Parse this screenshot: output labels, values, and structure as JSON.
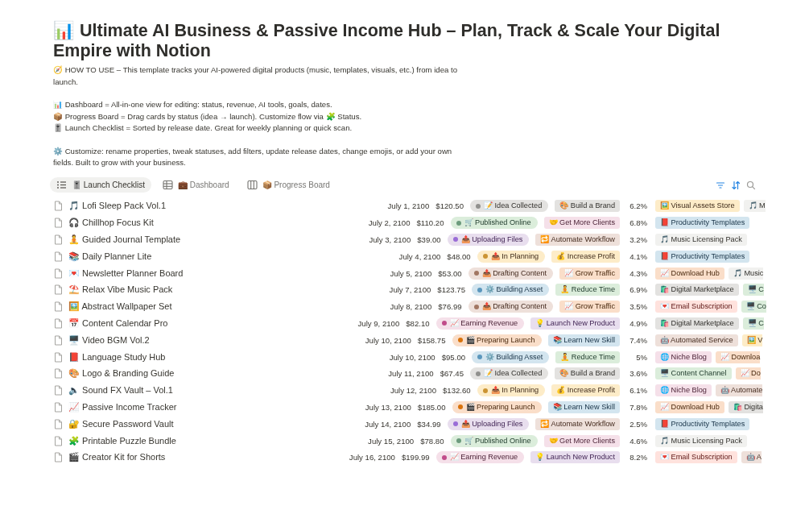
{
  "page": {
    "title": "📊 Ultimate AI Business & Passive Income Hub – Plan, Track & Scale Your Digital Empire with Notion"
  },
  "intro": [
    [
      "🧭 HOW TO USE – This template tracks your AI-powered digital products (music, templates, visuals, etc.) from idea to launch."
    ],
    [
      "📊 Dashboard = All-in-one view for editing: status, revenue, AI tools, goals, dates.",
      "📦 Progress Board = Drag cards by status (idea → launch). Customize flow via 🧩 Status.",
      "🎚️ Launch Checklist = Sorted by release date. Great for weekly planning or quick scan."
    ],
    [
      "⚙️ Customize: rename properties, tweak statuses, add filters, update release dates, change emojis, or add your own fields. Built to grow with your business."
    ]
  ],
  "tabs": [
    {
      "label": "🎚️ Launch Checklist",
      "kind": "list",
      "selected": true
    },
    {
      "label": "💼 Dashboard",
      "kind": "table",
      "selected": false
    },
    {
      "label": "📦 Progress Board",
      "kind": "board",
      "selected": false
    }
  ],
  "rows": [
    {
      "title": "🎵 Lofi Sleep Pack Vol.1",
      "date": "July 1, 2100",
      "revenue": "$120.50",
      "status": {
        "label": "📝 Idea Collected",
        "color": "#91918e"
      },
      "goal": {
        "label": "🎨 Build a Brand",
        "color": "#e3e2e0"
      },
      "rate": "6.2%",
      "channels": [
        {
          "label": "🖼️ Visual Assets Store",
          "color": "#fdecc8"
        },
        {
          "label": "🎵 M",
          "color": "#f1f1ef"
        }
      ]
    },
    {
      "title": "🎧 Chillhop Focus Kit",
      "date": "July 2, 2100",
      "revenue": "$110.20",
      "status": {
        "label": "🛒 Published Online",
        "color": "#6c9b7d"
      },
      "goal": {
        "label": "🤝 Get More Clients",
        "color": "#f5e0e9"
      },
      "rate": "6.8%",
      "channels": [
        {
          "label": "📕 Productivity Templates",
          "color": "#d3e5ef"
        }
      ]
    },
    {
      "title": "🧘 Guided Journal Template",
      "date": "July 3, 2100",
      "revenue": "$39.00",
      "status": {
        "label": "📤 Uploading Files",
        "color": "#9a6dd7"
      },
      "goal": {
        "label": "🔁 Automate Workflow",
        "color": "#eee0da"
      },
      "rate": "3.2%",
      "channels": [
        {
          "label": "🎵 Music Licensing Pack",
          "color": "#f1f1ef"
        }
      ]
    },
    {
      "title": "📚 Daily Planner Lite",
      "date": "July 4, 2100",
      "revenue": "$48.00",
      "status": {
        "label": "📤 In Planning",
        "color": "#cb9433"
      },
      "goal": {
        "label": "💰 Increase Profit",
        "color": "#fdecc8"
      },
      "rate": "4.1%",
      "channels": [
        {
          "label": "📕 Productivity Templates",
          "color": "#d3e5ef"
        }
      ]
    },
    {
      "title": "💌 Newsletter Planner Board",
      "date": "July 5, 2100",
      "revenue": "$53.00",
      "status": {
        "label": "📤 Drafting Content",
        "color": "#a27763"
      },
      "goal": {
        "label": "📈 Grow Traffic",
        "color": "#fadec9"
      },
      "rate": "4.3%",
      "channels": [
        {
          "label": "📈 Download Hub",
          "color": "#fadec9"
        },
        {
          "label": "🎵 Music",
          "color": "#f1f1ef"
        }
      ]
    },
    {
      "title": "⛱️ Relax Vibe Music Pack",
      "date": "July 7, 2100",
      "revenue": "$123.75",
      "status": {
        "label": "⚙️ Building Asset",
        "color": "#5b97bd"
      },
      "goal": {
        "label": "🧘 Reduce Time",
        "color": "#dbeddb"
      },
      "rate": "6.9%",
      "channels": [
        {
          "label": "🛍️ Digital Marketplace",
          "color": "#e3e2e0"
        },
        {
          "label": "🖥️ C",
          "color": "#dbeddb"
        }
      ]
    },
    {
      "title": "🖼️ Abstract Wallpaper Set",
      "date": "July 8, 2100",
      "revenue": "$76.99",
      "status": {
        "label": "📤 Drafting Content",
        "color": "#a27763"
      },
      "goal": {
        "label": "📈 Grow Traffic",
        "color": "#fadec9"
      },
      "rate": "3.5%",
      "channels": [
        {
          "label": "💌 Email Subscription",
          "color": "#ffe2dd"
        },
        {
          "label": "🖥️ Co",
          "color": "#dbeddb"
        }
      ]
    },
    {
      "title": "📅 Content Calendar Pro",
      "date": "July 9, 2100",
      "revenue": "$82.10",
      "status": {
        "label": "📈 Earning Revenue",
        "color": "#c14c8a"
      },
      "goal": {
        "label": "💡 Launch New Product",
        "color": "#e8deee"
      },
      "rate": "4.9%",
      "channels": [
        {
          "label": "🛍️ Digital Marketplace",
          "color": "#e3e2e0"
        },
        {
          "label": "🖥️ C",
          "color": "#dbeddb"
        }
      ]
    },
    {
      "title": "🖥️ Video BGM Vol.2",
      "date": "July 10, 2100",
      "revenue": "$158.75",
      "status": {
        "label": "🎬 Preparing Launch",
        "color": "#d9730d"
      },
      "goal": {
        "label": "📚 Learn New Skill",
        "color": "#d3e5ef"
      },
      "rate": "7.4%",
      "channels": [
        {
          "label": "🤖 Automated Service",
          "color": "#eee0da"
        },
        {
          "label": "🖼️ V",
          "color": "#fdecc8"
        }
      ]
    },
    {
      "title": "📕 Language Study Hub",
      "date": "July 10, 2100",
      "revenue": "$95.00",
      "status": {
        "label": "⚙️ Building Asset",
        "color": "#5b97bd"
      },
      "goal": {
        "label": "🧘 Reduce Time",
        "color": "#dbeddb"
      },
      "rate": "5%",
      "channels": [
        {
          "label": "🌐 Niche Blog",
          "color": "#f5e0e9"
        },
        {
          "label": "📈 Downloa",
          "color": "#fadec9"
        }
      ]
    },
    {
      "title": "🎨 Logo & Branding Guide",
      "date": "July 11, 2100",
      "revenue": "$67.45",
      "status": {
        "label": "📝 Idea Collected",
        "color": "#91918e"
      },
      "goal": {
        "label": "🎨 Build a Brand",
        "color": "#e3e2e0"
      },
      "rate": "3.6%",
      "channels": [
        {
          "label": "🖥️ Content Channel",
          "color": "#dbeddb"
        },
        {
          "label": "📈 Do",
          "color": "#fadec9"
        }
      ]
    },
    {
      "title": "🔈 Sound FX Vault – Vol.1",
      "date": "July 12, 2100",
      "revenue": "$132.60",
      "status": {
        "label": "📤 In Planning",
        "color": "#cb9433"
      },
      "goal": {
        "label": "💰 Increase Profit",
        "color": "#fdecc8"
      },
      "rate": "6.1%",
      "channels": [
        {
          "label": "🌐 Niche Blog",
          "color": "#f5e0e9"
        },
        {
          "label": "🤖 Automate",
          "color": "#eee0da"
        }
      ]
    },
    {
      "title": "📈 Passive Income Tracker",
      "date": "July 13, 2100",
      "revenue": "$185.00",
      "status": {
        "label": "🎬 Preparing Launch",
        "color": "#d9730d"
      },
      "goal": {
        "label": "📚 Learn New Skill",
        "color": "#d3e5ef"
      },
      "rate": "7.8%",
      "channels": [
        {
          "label": "📈 Download Hub",
          "color": "#fadec9"
        },
        {
          "label": "🛍️ Digita",
          "color": "#e3e2e0"
        }
      ]
    },
    {
      "title": "🔐 Secure Password Vault",
      "date": "July 14, 2100",
      "revenue": "$34.99",
      "status": {
        "label": "📤 Uploading Files",
        "color": "#9a6dd7"
      },
      "goal": {
        "label": "🔁 Automate Workflow",
        "color": "#eee0da"
      },
      "rate": "2.5%",
      "channels": [
        {
          "label": "📕 Productivity Templates",
          "color": "#d3e5ef"
        }
      ]
    },
    {
      "title": "🧩 Printable Puzzle Bundle",
      "date": "July 15, 2100",
      "revenue": "$78.80",
      "status": {
        "label": "🛒 Published Online",
        "color": "#6c9b7d"
      },
      "goal": {
        "label": "🤝 Get More Clients",
        "color": "#f5e0e9"
      },
      "rate": "4.6%",
      "channels": [
        {
          "label": "🎵 Music Licensing Pack",
          "color": "#f1f1ef"
        }
      ]
    },
    {
      "title": "🎬 Creator Kit for Shorts",
      "date": "July 16, 2100",
      "revenue": "$199.99",
      "status": {
        "label": "📈 Earning Revenue",
        "color": "#c14c8a"
      },
      "goal": {
        "label": "💡 Launch New Product",
        "color": "#e8deee"
      },
      "rate": "8.2%",
      "channels": [
        {
          "label": "💌 Email Subscription",
          "color": "#ffe2dd"
        },
        {
          "label": "🤖 A",
          "color": "#eee0da"
        }
      ]
    }
  ]
}
